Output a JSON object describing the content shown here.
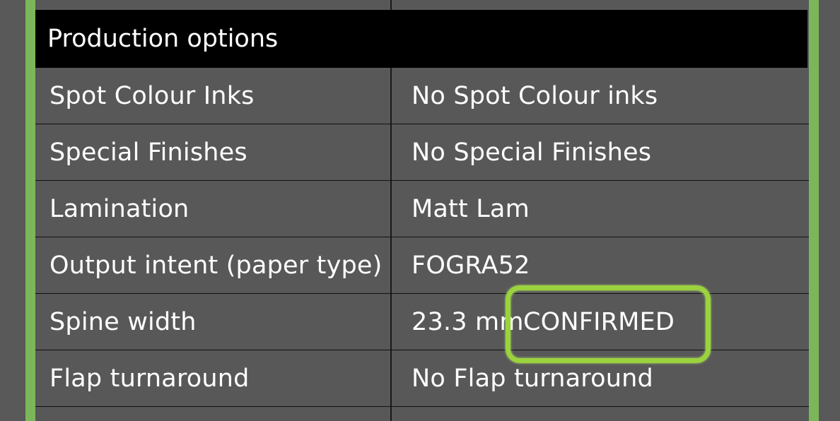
{
  "section": {
    "title": "Production options"
  },
  "rows": [
    {
      "label": "Spot Colour Inks",
      "value": "No Spot Colour inks"
    },
    {
      "label": "Special Finishes",
      "value": "No Special Finishes"
    },
    {
      "label": "Lamination",
      "value": "Matt Lam"
    },
    {
      "label": "Output intent (paper type)",
      "value": "FOGRA52"
    },
    {
      "label": "Spine width",
      "value": "23.3 mm"
    },
    {
      "label": "Flap turnaround",
      "value": "No Flap turnaround"
    }
  ],
  "annotation": {
    "text": "CONFIRMED"
  },
  "colors": {
    "accent_border": "#7cb65a",
    "highlight": "#9ad33d",
    "header_bg": "#000000",
    "cell_bg": "#585858"
  }
}
